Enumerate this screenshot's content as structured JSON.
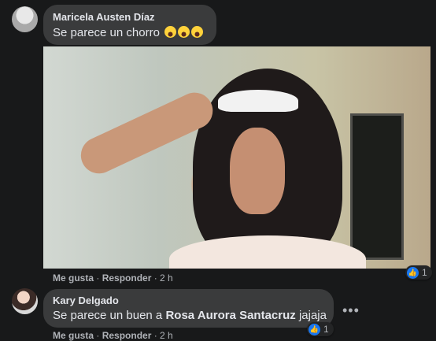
{
  "comments": [
    {
      "author": "Maricela Austen Díaz",
      "text": "Se parece un chorro",
      "emoji": [
        "face-with-tears-of-joy",
        "face-with-tears-of-joy",
        "face-with-tears-of-joy"
      ],
      "actions": [
        "Me gusta",
        "Responder"
      ],
      "time": "2 h",
      "reaction_count": "1"
    },
    {
      "author": "Kary Delgado",
      "text_prefix": "Se parece un buen a ",
      "mention": "Rosa Aurora Santacruz",
      "text_suffix": " jajaja",
      "actions": [
        "Me gusta",
        "Responder"
      ],
      "time": "2 h",
      "reaction_count": "1"
    }
  ],
  "icons": {
    "like": "like-icon",
    "more": "more-options-icon"
  },
  "colors": {
    "background": "#18191a",
    "bubble": "#3a3b3c",
    "secondary_text": "#b0b3b8",
    "like_blue": "#1877f2"
  }
}
